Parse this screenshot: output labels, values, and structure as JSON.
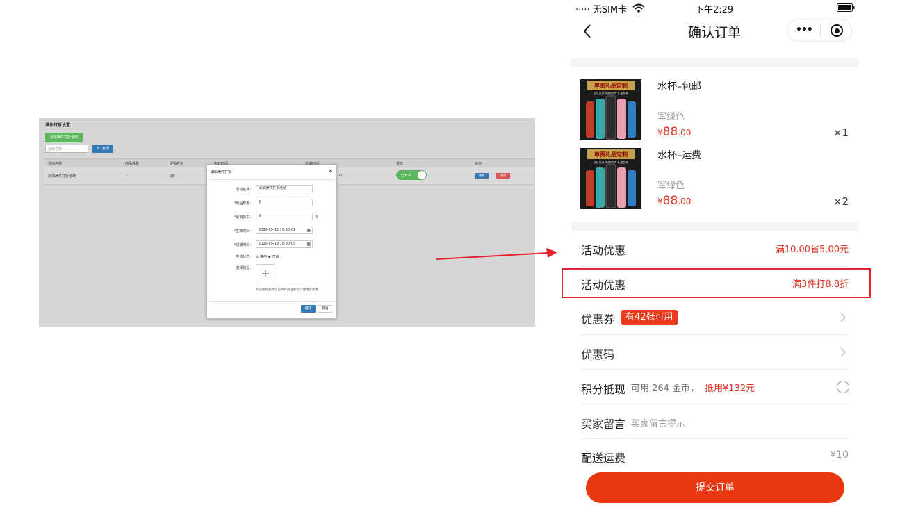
{
  "admin": {
    "title": "满件打折设置",
    "add_button": "添加满件打折活动",
    "search_placeholder": "活动名称",
    "search_button": "查询",
    "columns": [
      "活动名称",
      "商品数量",
      "促销折扣",
      "生效时间",
      "过期时间",
      "状态",
      "操作"
    ],
    "row": {
      "name": "添加满件打折活动",
      "qty": "2",
      "discount": "9折",
      "expire_tail": "05",
      "status": "已开启",
      "edit": "编辑",
      "delete": "删除"
    },
    "modal": {
      "title": "编辑满件打折",
      "close": "×",
      "fields": {
        "name_label": "活动名称:",
        "name_value": "添加满件打折活动",
        "qty_label": "商品数量:",
        "qty_value": "2",
        "discount_label": "促销折扣:",
        "discount_value": "9",
        "discount_unit": "折",
        "start_label": "生效时间:",
        "start_value": "2020-05-12 16:30:01",
        "end_label": "过期时间:",
        "end_value": "2020-05-19 16:30:05",
        "status_label": "生效状态:",
        "status_options": "◎ 禁用  ◉ 开启",
        "goods_label": "选择商品:",
        "upload": "+",
        "tip": "不选择商品默认是所有商品都可以使用此优惠"
      },
      "confirm": "确定",
      "cancel": "取消"
    }
  },
  "phone": {
    "status_bar": {
      "carrier": "····· 无SIM卡",
      "wifi": "wifi",
      "time": "下午2:29",
      "battery": "battery"
    },
    "nav": {
      "back": "back-icon",
      "title": "确认订单"
    },
    "products": [
      {
        "name": "水杯–包邮",
        "spec": "军绿色",
        "price_sym": "¥",
        "price_int": "88",
        "price_dec": ".00",
        "qty": "×1",
        "img_banner": "尊贵礼品定制",
        "img_sub": "团队设计 免费刻字 礼盒包装"
      },
      {
        "name": "水杯–运费",
        "spec": "军绿色",
        "price_sym": "¥",
        "price_int": "88",
        "price_dec": ".00",
        "qty": "×2",
        "img_banner": "尊贵礼品定制",
        "img_sub": "团队设计 免费刻字 礼盒包装"
      }
    ],
    "rows": {
      "promo1_label": "活动优惠",
      "promo1_value": "满10.00省5.00元",
      "promo2_label": "活动优惠",
      "promo2_value": "满3件打8.8折",
      "coupon_label": "优惠券",
      "coupon_badge": "有42张可用",
      "code_label": "优惠码",
      "points_label": "积分抵现",
      "points_sub": "可用 264 金币，",
      "points_red": "抵用¥132元",
      "msg_label": "买家留言",
      "msg_placeholder": "买家留言提示",
      "ship_label": "配送运费",
      "ship_value": "¥10"
    },
    "submit": "提交订单"
  },
  "colors": {
    "accent": "#e9380f",
    "highlight": "#e3212b",
    "green": "#5cb85c",
    "blue": "#337ab7"
  }
}
